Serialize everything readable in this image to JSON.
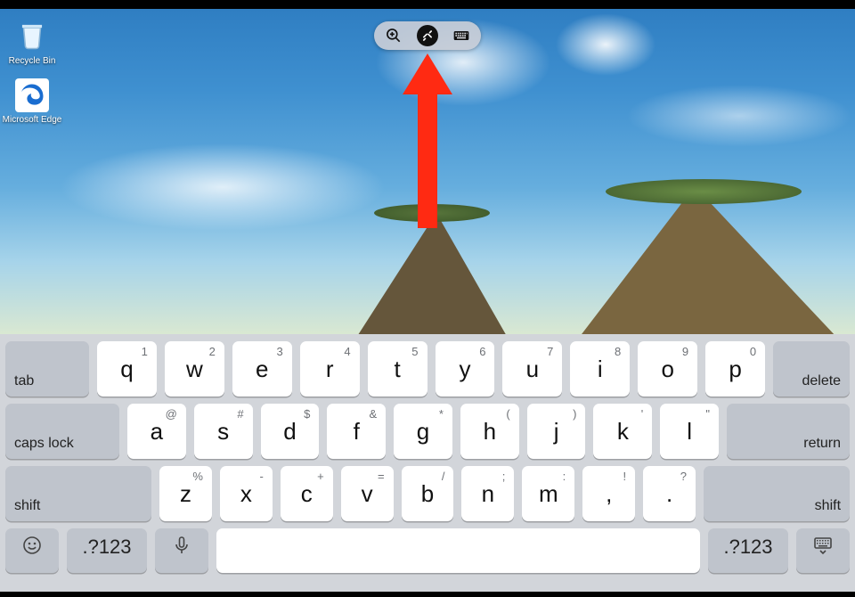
{
  "desktop_icons": [
    {
      "id": "recycle-bin",
      "label": "Recycle Bin"
    },
    {
      "id": "microsoft-edge",
      "label": "Microsoft Edge"
    }
  ],
  "remote_toolbar": {
    "zoom_icon": "zoom-in",
    "connection_icon": "remote-connection",
    "keyboard_icon": "toggle-keyboard"
  },
  "annotation": {
    "arrow_color": "#ff2a12",
    "arrow_direction": "up"
  },
  "keyboard": {
    "row1": {
      "left_fn": "tab",
      "keys": [
        {
          "main": "q",
          "sup": "1"
        },
        {
          "main": "w",
          "sup": "2"
        },
        {
          "main": "e",
          "sup": "3"
        },
        {
          "main": "r",
          "sup": "4"
        },
        {
          "main": "t",
          "sup": "5"
        },
        {
          "main": "y",
          "sup": "6"
        },
        {
          "main": "u",
          "sup": "7"
        },
        {
          "main": "i",
          "sup": "8"
        },
        {
          "main": "o",
          "sup": "9"
        },
        {
          "main": "p",
          "sup": "0"
        }
      ],
      "right_fn": "delete"
    },
    "row2": {
      "left_fn": "caps lock",
      "keys": [
        {
          "main": "a",
          "sup": "@"
        },
        {
          "main": "s",
          "sup": "#"
        },
        {
          "main": "d",
          "sup": "$"
        },
        {
          "main": "f",
          "sup": "&"
        },
        {
          "main": "g",
          "sup": "*"
        },
        {
          "main": "h",
          "sup": "("
        },
        {
          "main": "j",
          "sup": ")"
        },
        {
          "main": "k",
          "sup": "'"
        },
        {
          "main": "l",
          "sup": "\""
        }
      ],
      "right_fn": "return"
    },
    "row3": {
      "left_fn": "shift",
      "keys": [
        {
          "main": "z",
          "sup": "%"
        },
        {
          "main": "x",
          "sup": "-"
        },
        {
          "main": "c",
          "sup": "+"
        },
        {
          "main": "v",
          "sup": "="
        },
        {
          "main": "b",
          "sup": "/"
        },
        {
          "main": "n",
          "sup": ";"
        },
        {
          "main": "m",
          "sup": ":"
        },
        {
          "main": ",",
          "sup": "!"
        },
        {
          "main": ".",
          "sup": "?"
        }
      ],
      "right_fn": "shift"
    },
    "row4": {
      "emoji": "emoji",
      "numbers_left": ".?123",
      "mic": "dictate",
      "space": "",
      "numbers_right": ".?123",
      "dismiss": "hide-keyboard"
    }
  }
}
